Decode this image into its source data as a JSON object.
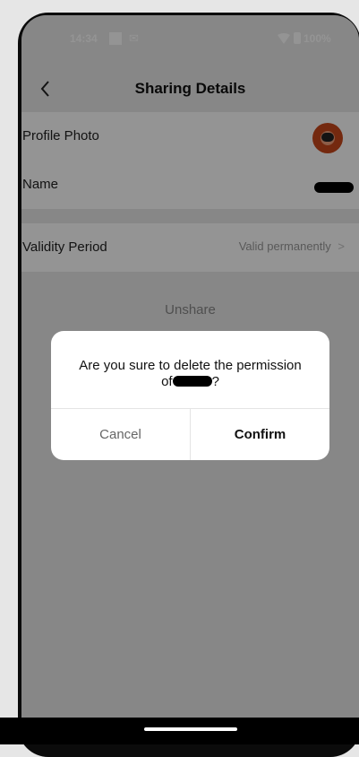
{
  "status_bar": {
    "time": "14:34",
    "mail_icon": "✉",
    "battery": "100%"
  },
  "header": {
    "title": "Sharing Details",
    "back_icon": "chevron-left-icon"
  },
  "details": {
    "profile_photo_label": "Profile Photo",
    "name_label": "Name",
    "validity_label": "Validity Period",
    "validity_value": "Valid permanently",
    "validity_chevron": ">"
  },
  "unshare_label": "Unshare",
  "dialog": {
    "message_line1": "Are you sure to delete the permission",
    "message_line2_prefix": "of",
    "message_line2_suffix": "?",
    "cancel_label": "Cancel",
    "confirm_label": "Confirm"
  },
  "colors": {
    "overlay": "#000000",
    "title_text": "#111111",
    "secondary_text": "#9a9a9a",
    "avatar_accent": "#c9481b"
  }
}
